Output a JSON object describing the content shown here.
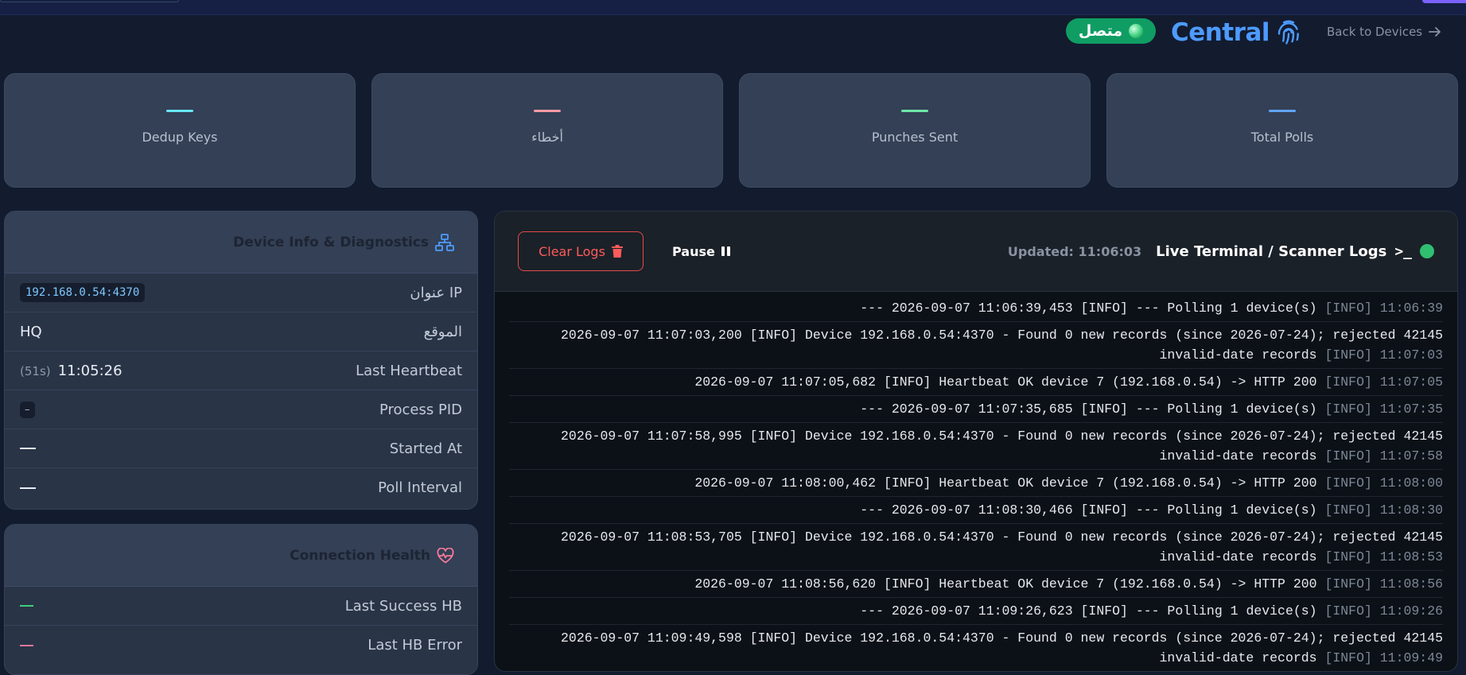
{
  "header": {
    "status_text": "متصل",
    "brand_name": "Central",
    "back_label": "Back to Devices"
  },
  "stats": [
    {
      "label": "Dedup Keys",
      "color": "#67e8f9"
    },
    {
      "label": "أخطاء",
      "color": "#fb9aa4"
    },
    {
      "label": "Punches Sent",
      "color": "#6ee7a8"
    },
    {
      "label": "Total Polls",
      "color": "#60a5fa"
    }
  ],
  "device_panel": {
    "title": "Device Info & Diagnostics",
    "rows": [
      {
        "key": "عنوان IP",
        "value": "192.168.0.54:4370"
      },
      {
        "key": "الموقع",
        "value": "HQ"
      },
      {
        "key": "Last Heartbeat",
        "value": "11:05:26",
        "ago": "(51s)"
      },
      {
        "key": "Process PID",
        "value": "–"
      },
      {
        "key": "Started At",
        "value": ""
      },
      {
        "key": "Poll Interval",
        "value": ""
      }
    ]
  },
  "health_panel": {
    "title": "Connection Health",
    "rows": [
      {
        "key": "Last Success HB"
      },
      {
        "key": "Last HB Error"
      }
    ]
  },
  "terminal": {
    "clear_label": "Clear Logs",
    "pause_label": "Pause",
    "updated": "Updated: 11:06:03",
    "title": "Live Terminal / Scanner Logs",
    "logs": [
      {
        "text": "--- 2026-09-07 11:06:39,453 [INFO] --- Polling 1 device(s)",
        "ts": "[INFO] 11:06:39"
      },
      {
        "text": "2026-09-07 11:07:03,200 [INFO] Device 192.168.0.54:4370 - Found 0 new records (since 2026-07-24); rejected 42145 invalid-date records",
        "ts": "[INFO] 11:07:03"
      },
      {
        "text": "2026-09-07 11:07:05,682 [INFO] Heartbeat OK device 7 (192.168.0.54) -> HTTP 200",
        "ts": "[INFO] 11:07:05"
      },
      {
        "text": "--- 2026-09-07 11:07:35,685 [INFO] --- Polling 1 device(s)",
        "ts": "[INFO] 11:07:35"
      },
      {
        "text": "2026-09-07 11:07:58,995 [INFO] Device 192.168.0.54:4370 - Found 0 new records (since 2026-07-24); rejected 42145 invalid-date records",
        "ts": "[INFO] 11:07:58"
      },
      {
        "text": "2026-09-07 11:08:00,462 [INFO] Heartbeat OK device 7 (192.168.0.54) -> HTTP 200",
        "ts": "[INFO] 11:08:00"
      },
      {
        "text": "--- 2026-09-07 11:08:30,466 [INFO] --- Polling 1 device(s)",
        "ts": "[INFO] 11:08:30"
      },
      {
        "text": "2026-09-07 11:08:53,705 [INFO] Device 192.168.0.54:4370 - Found 0 new records (since 2026-07-24); rejected 42145 invalid-date records",
        "ts": "[INFO] 11:08:53"
      },
      {
        "text": "2026-09-07 11:08:56,620 [INFO] Heartbeat OK device 7 (192.168.0.54) -> HTTP 200",
        "ts": "[INFO] 11:08:56"
      },
      {
        "text": "--- 2026-09-07 11:09:26,623 [INFO] --- Polling 1 device(s)",
        "ts": "[INFO] 11:09:26"
      },
      {
        "text": "2026-09-07 11:09:49,598 [INFO] Device 192.168.0.54:4370 - Found 0 new records (since 2026-07-24); rejected 42145 invalid-date records",
        "ts": "[INFO] 11:09:49"
      }
    ]
  }
}
